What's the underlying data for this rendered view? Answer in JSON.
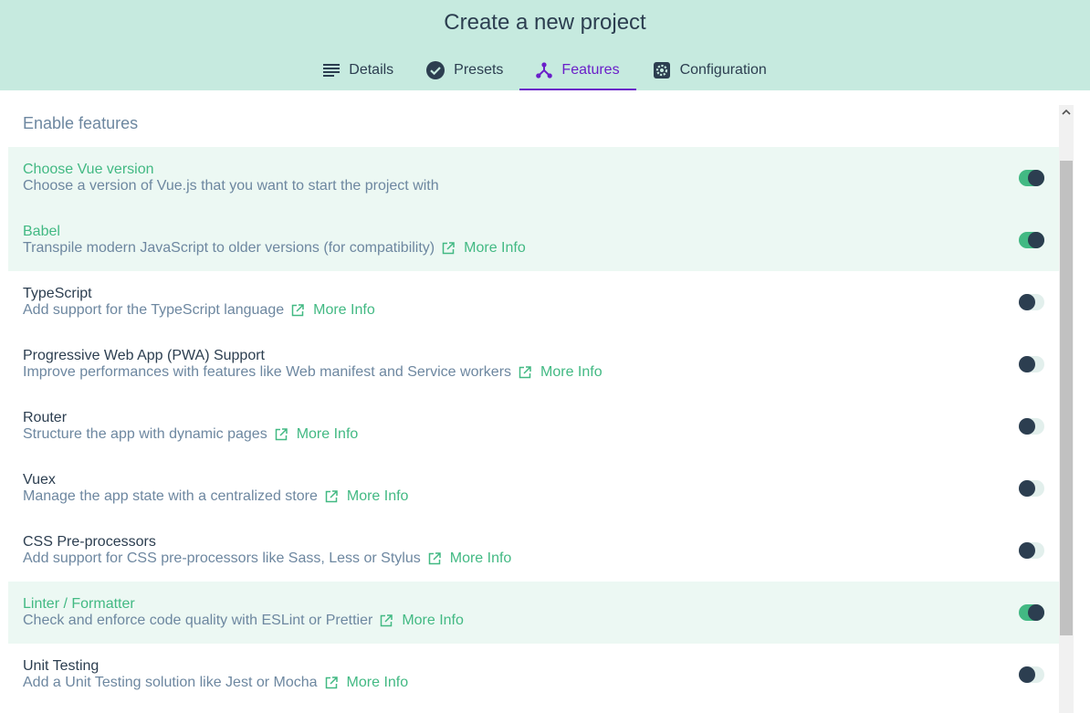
{
  "header": {
    "title": "Create a new project",
    "tabs": [
      {
        "label": "Details",
        "icon": "details-lines-icon",
        "active": false
      },
      {
        "label": "Presets",
        "icon": "check-circle-icon",
        "active": false
      },
      {
        "label": "Features",
        "icon": "fork-icon",
        "active": true
      },
      {
        "label": "Configuration",
        "icon": "gear-icon",
        "active": false
      }
    ]
  },
  "main": {
    "section_title": "Enable features",
    "more_info_label": "More Info",
    "features": [
      {
        "name": "Choose Vue version",
        "description": "Choose a version of Vue.js that you want to start the project with",
        "enabled": true,
        "has_link": false
      },
      {
        "name": "Babel",
        "description": "Transpile modern JavaScript to older versions (for compatibility)",
        "enabled": true,
        "has_link": true,
        "link_label": "More Info"
      },
      {
        "name": "TypeScript",
        "description": "Add support for the TypeScript language",
        "enabled": false,
        "has_link": true,
        "link_label": "More Info"
      },
      {
        "name": "Progressive Web App (PWA) Support",
        "description": "Improve performances with features like Web manifest and Service workers",
        "enabled": false,
        "has_link": true,
        "link_label": "More Info"
      },
      {
        "name": "Router",
        "description": "Structure the app with dynamic pages",
        "enabled": false,
        "has_link": true,
        "link_label": "More Info"
      },
      {
        "name": "Vuex",
        "description": "Manage the app state with a centralized store",
        "enabled": false,
        "has_link": true,
        "link_label": "More Info"
      },
      {
        "name": "CSS Pre-processors",
        "description": "Add support for CSS pre-processors like Sass, Less or Stylus",
        "enabled": false,
        "has_link": true,
        "link_label": "More Info"
      },
      {
        "name": "Linter / Formatter",
        "description": "Check and enforce code quality with ESLint or Prettier",
        "enabled": true,
        "has_link": true,
        "link_label": "More Info"
      },
      {
        "name": "Unit Testing",
        "description": "Add a Unit Testing solution like Jest or Mocha",
        "enabled": false,
        "has_link": true,
        "link_label": "More Info"
      }
    ]
  },
  "colors": {
    "header_bg": "#c6eadf",
    "accent_green": "#42b983",
    "active_tab": "#6a1fc9",
    "text_dark": "#2c3e50",
    "text_muted": "#6d87a0",
    "enabled_row_bg": "#ecf8f3"
  }
}
